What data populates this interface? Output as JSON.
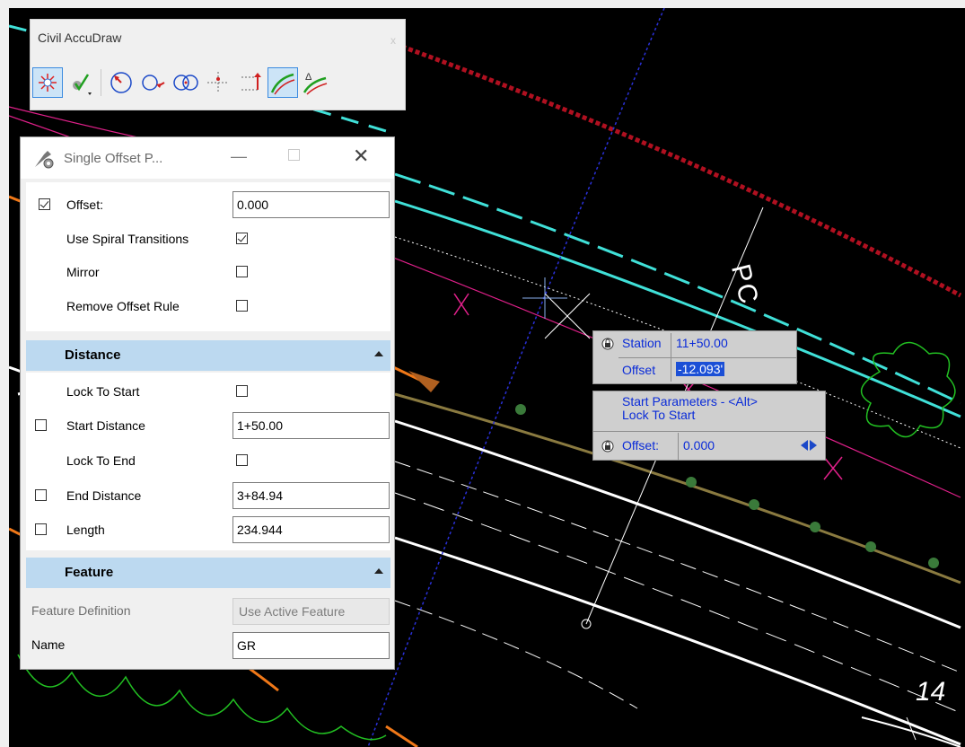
{
  "accudraw": {
    "title": "Civil AccuDraw",
    "close_label": "x",
    "tools": [
      "accudraw-origin-icon",
      "accudraw-check-icon",
      "rotate-circle-icon",
      "circle-arrow-icon",
      "two-circles-icon",
      "crosshair-icon",
      "bracket-arrow-icon",
      "offset-curve-icon",
      "delta-curve-icon"
    ]
  },
  "panel": {
    "title": "Single Offset P...",
    "minimize_label": "—",
    "close_label": "✕",
    "params": [
      {
        "label": "Offset:",
        "checked": true,
        "value": "0.000"
      },
      {
        "label": "Use Spiral Transitions",
        "checked": true
      },
      {
        "label": "Mirror",
        "checked": false
      },
      {
        "label": "Remove Offset Rule",
        "checked": false
      }
    ],
    "distance": {
      "header": "Distance",
      "lock_to_start": "Lock To Start",
      "start_distance": "Start Distance",
      "start_distance_value": "1+50.00",
      "lock_to_end": "Lock To End",
      "end_distance": "End Distance",
      "end_distance_value": "3+84.94",
      "length": "Length",
      "length_value": "234.944"
    },
    "feature": {
      "header": "Feature",
      "definition_label": "Feature Definition",
      "definition_value": "Use Active Feature",
      "name_label": "Name",
      "name_value": "GR"
    }
  },
  "tooltip": {
    "station_label": "Station",
    "station_value": "11+50.00",
    "offset_label": "Offset",
    "offset_value": "-12.093'",
    "params_line1": "Start Parameters - <Alt>",
    "params_line2": "Lock To Start",
    "offset2_label": "Offset:",
    "offset2_value": "0.000"
  },
  "canvas": {
    "pc_label": "PC",
    "station_label": "14",
    "colors": {
      "background": "#000000",
      "cyan": "#40e0d8",
      "red_dashed": "#b01020",
      "magenta": "#e0208a",
      "orange": "#f07818",
      "olive": "#8a7a40",
      "green": "#22c022",
      "blue_dashed": "#2a30d8",
      "accent": "#1b4fd6"
    }
  }
}
